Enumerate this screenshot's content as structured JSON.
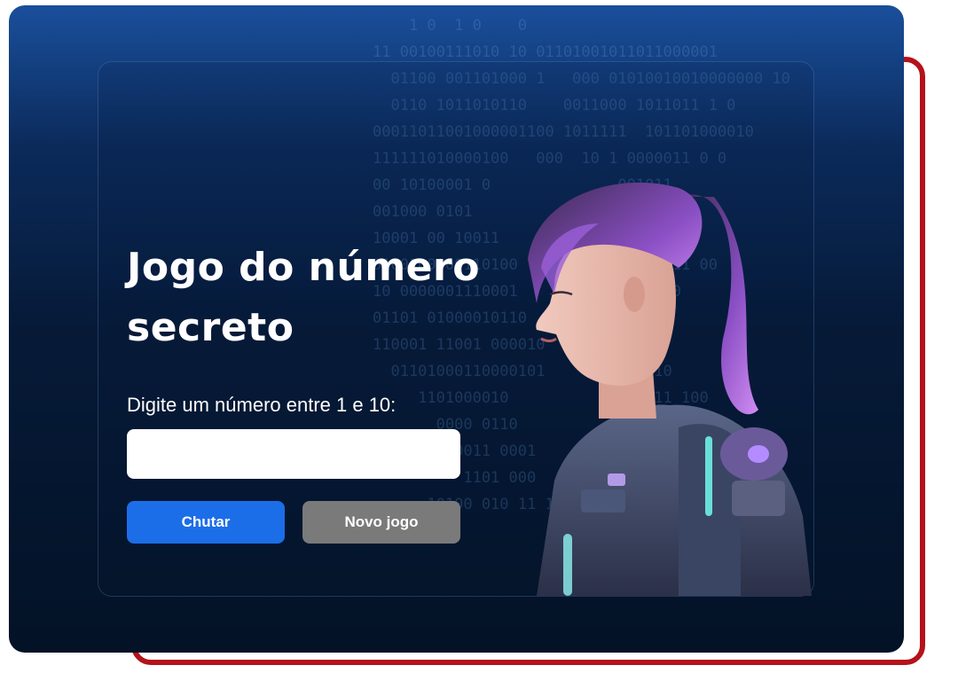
{
  "page": {
    "title": "Jogo do número secreto",
    "prompt": "Digite um número entre 1 e 10:",
    "input_value": "",
    "input_placeholder": ""
  },
  "buttons": {
    "guess_label": "Chutar",
    "new_game_label": "Novo jogo"
  },
  "colors": {
    "frame_accent": "#b5121b",
    "primary_button": "#1c6ee8",
    "secondary_button": "#7a7a7a",
    "background_top": "#1a4f9c",
    "background_bottom": "#031226"
  },
  "decor": {
    "binary_lines": [
      "    1 0  1 0    0",
      "11 00100111010 10 01101001011011000001",
      "  01100 001101000 1   000 01010010010000000 10",
      "  0110 1011010110    0011000 1011011 1 0",
      "00011011001000001100 1011111  101101000010",
      "111111010000100   000  10 1 0000011 0 0",
      "00 10100001 0              001011",
      "001000 0101                001 10 0",
      "10001 00 10011           10001 01101",
      "0100100000110100           00100011 00",
      "10 0000001110001         0       0",
      "01101 01000010110        11 01000",
      "110001 11001 000010     1000110",
      "  01101000110000101       10 1010",
      "     1101000010          1 1 0 11 100",
      "       0000 0110          11 0",
      "         0011 0001          0",
      "          1101 000          0 1",
      "      10100 010 11 10        0"
    ]
  },
  "hero_image": {
    "icon": "astronaut-girl-illustration"
  }
}
